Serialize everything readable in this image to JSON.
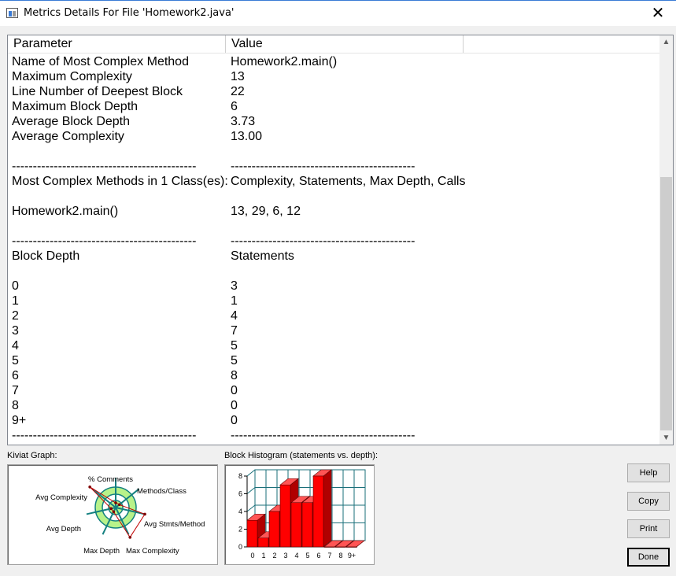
{
  "window": {
    "title": "Metrics Details For File 'Homework2.java'",
    "close_glyph": "✕"
  },
  "table": {
    "headers": [
      "Parameter",
      "Value",
      ""
    ],
    "rows": [
      {
        "p": "Name of Most Complex Method",
        "v": "Homework2.main()"
      },
      {
        "p": "Maximum Complexity",
        "v": "13"
      },
      {
        "p": "Line Number of Deepest Block",
        "v": "22"
      },
      {
        "p": "Maximum Block Depth",
        "v": "6"
      },
      {
        "p": "Average Block Depth",
        "v": "3.73"
      },
      {
        "p": "Average Complexity",
        "v": "13.00"
      },
      {
        "p": "",
        "v": ""
      },
      {
        "p": "--------------------------------------------",
        "v": "--------------------------------------------"
      },
      {
        "p": "Most Complex Methods in 1 Class(es):",
        "v": "Complexity, Statements, Max Depth, Calls"
      },
      {
        "p": "",
        "v": ""
      },
      {
        "p": "Homework2.main()",
        "v": "13, 29, 6, 12"
      },
      {
        "p": "",
        "v": ""
      },
      {
        "p": "--------------------------------------------",
        "v": "--------------------------------------------"
      },
      {
        "p": "Block Depth",
        "v": "Statements"
      },
      {
        "p": "",
        "v": ""
      },
      {
        "p": "0",
        "v": "3"
      },
      {
        "p": "1",
        "v": "1"
      },
      {
        "p": "2",
        "v": "4"
      },
      {
        "p": "3",
        "v": "7"
      },
      {
        "p": "4",
        "v": "5"
      },
      {
        "p": "5",
        "v": "5"
      },
      {
        "p": "6",
        "v": "8"
      },
      {
        "p": "7",
        "v": "0"
      },
      {
        "p": "8",
        "v": "0"
      },
      {
        "p": "9+",
        "v": "0"
      },
      {
        "p": "--------------------------------------------",
        "v": "--------------------------------------------"
      }
    ]
  },
  "kiviat": {
    "label": "Kiviat Graph:",
    "axes": [
      "% Comments",
      "Methods/Class",
      "Avg Stmts/Method",
      "Max Complexity",
      "Max Depth",
      "Avg Depth",
      "Avg Complexity"
    ],
    "values": [
      0.05,
      0.05,
      0.85,
      0.95,
      0.05,
      0.05,
      0.95
    ]
  },
  "histogram": {
    "label": "Block Histogram (statements vs. depth):",
    "categories": [
      "0",
      "1",
      "2",
      "3",
      "4",
      "5",
      "6",
      "7",
      "8",
      "9+"
    ],
    "values": [
      3,
      1,
      4,
      7,
      5,
      5,
      8,
      0,
      0,
      0
    ],
    "y_ticks": [
      "0",
      "2",
      "4",
      "6",
      "8"
    ],
    "ylim": [
      0,
      8
    ],
    "bar_color": "#ff0000"
  },
  "buttons": {
    "help": "Help",
    "copy": "Copy",
    "print": "Print",
    "done": "Done"
  }
}
